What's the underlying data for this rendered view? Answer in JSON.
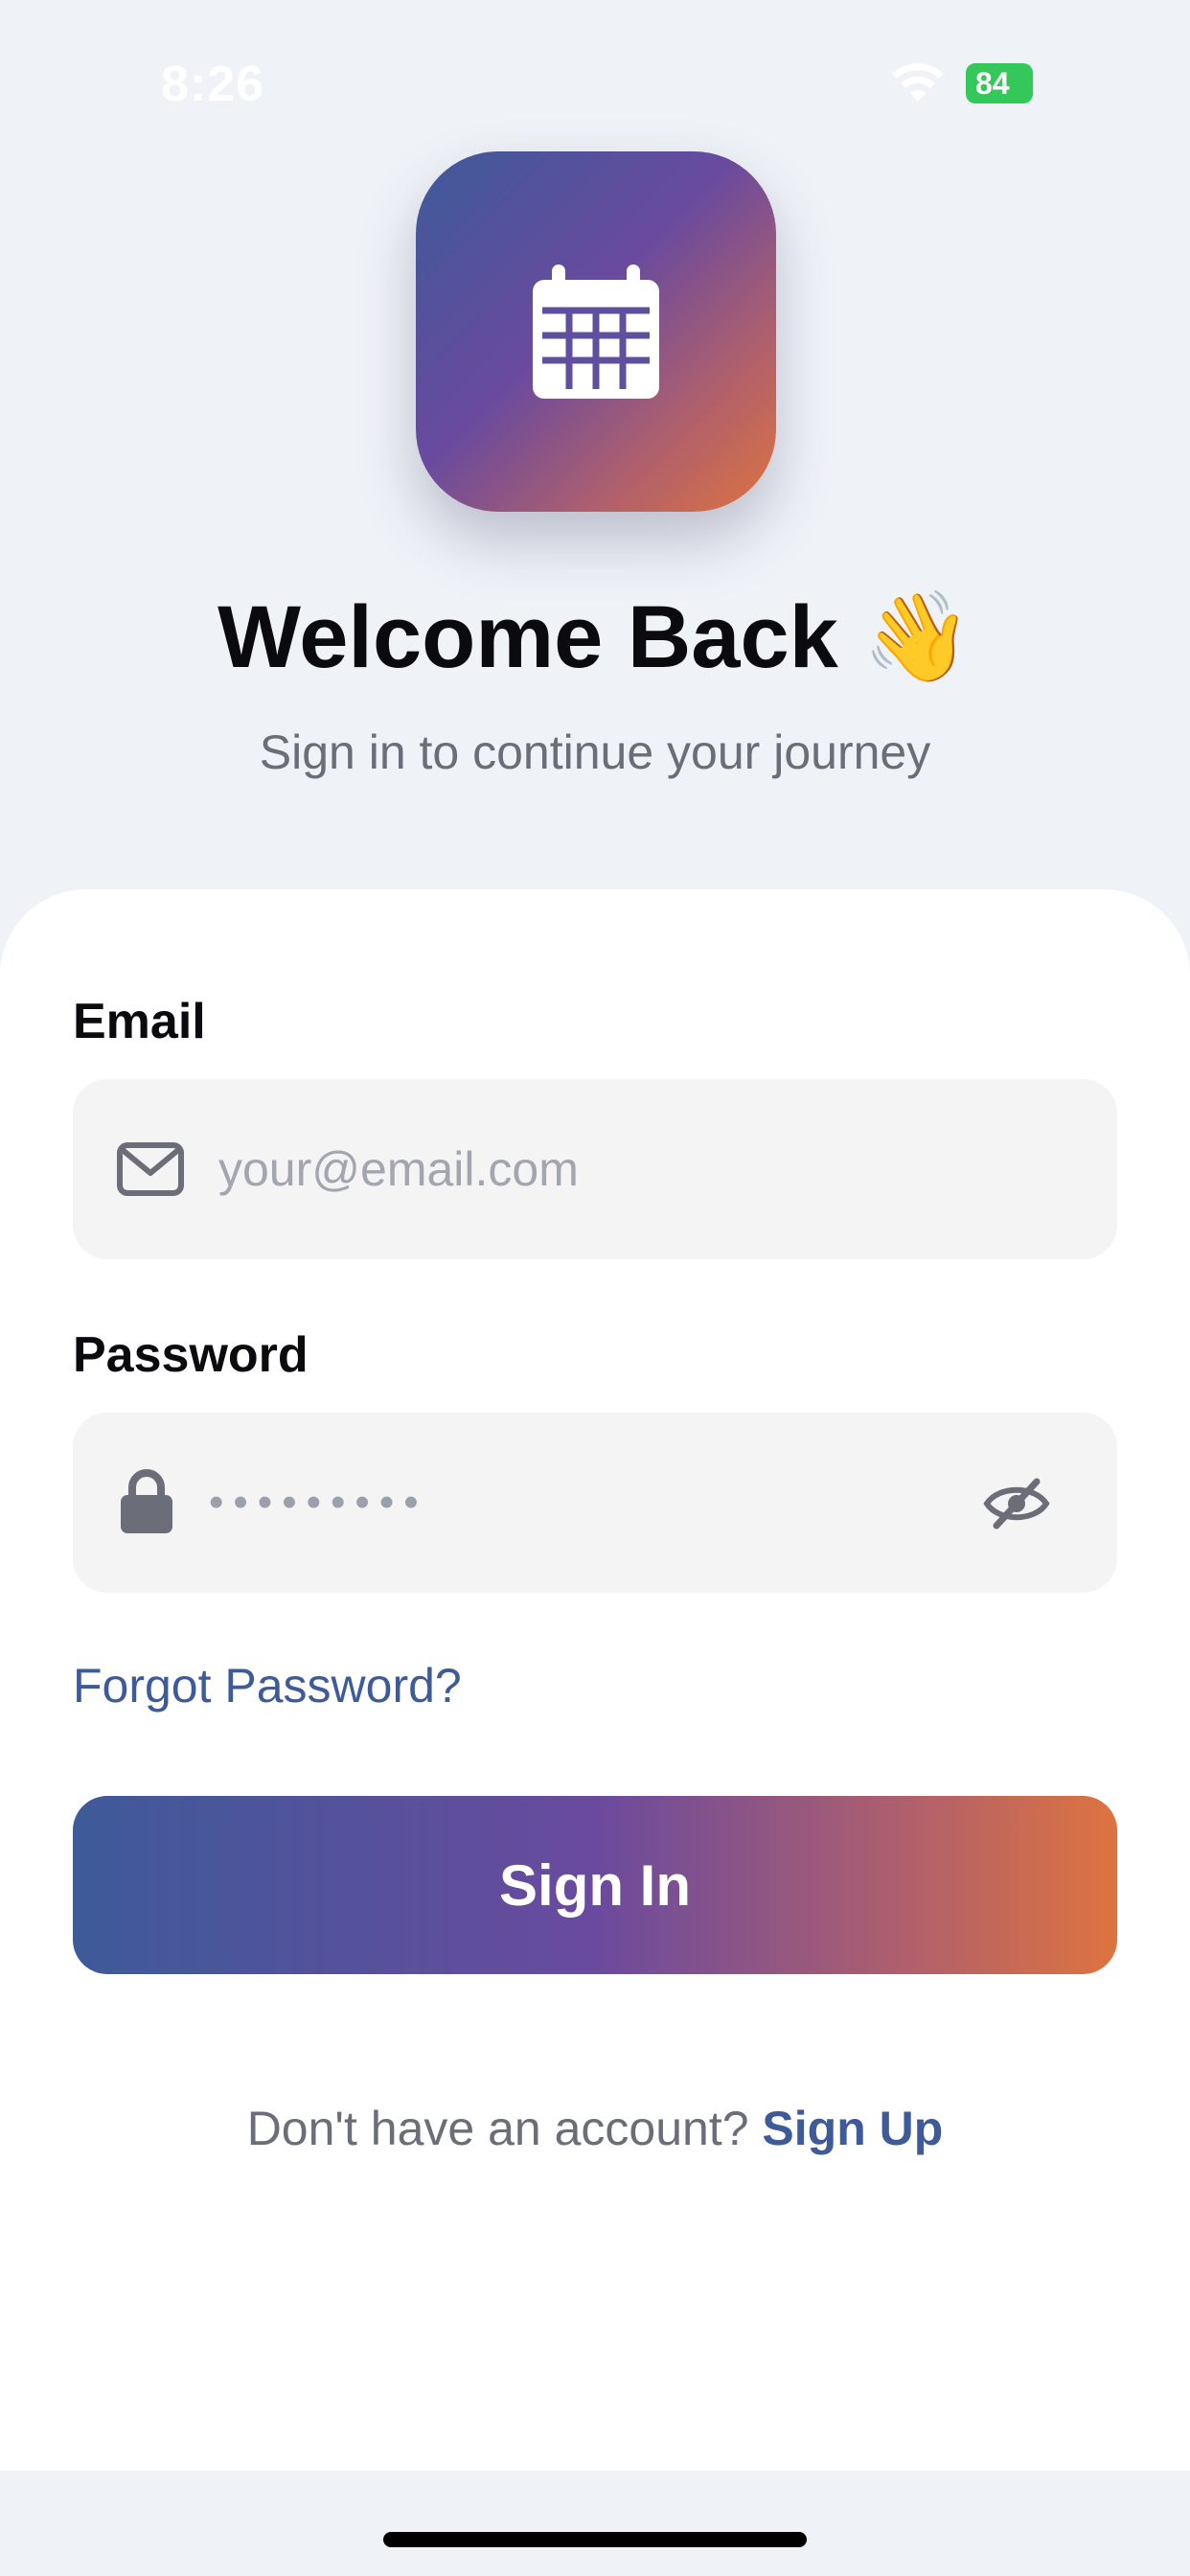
{
  "status_bar": {
    "time": "8:26",
    "battery": "84"
  },
  "header": {
    "app_icon": "calendar-icon",
    "title": "Welcome Back 👋",
    "subtitle": "Sign in to continue your journey"
  },
  "form": {
    "email_label": "Email",
    "email_placeholder": "your@email.com",
    "password_label": "Password",
    "password_mask": "•••••••••",
    "forgot_password": "Forgot Password?",
    "sign_in": "Sign In",
    "no_account": "Don't have an account?",
    "sign_up": "Sign Up"
  },
  "colors": {
    "accent": "#3d5a99",
    "gradient_start": "#3d5a99",
    "gradient_mid": "#6a4a9e",
    "gradient_end": "#dd733f",
    "battery": "#34c759"
  }
}
